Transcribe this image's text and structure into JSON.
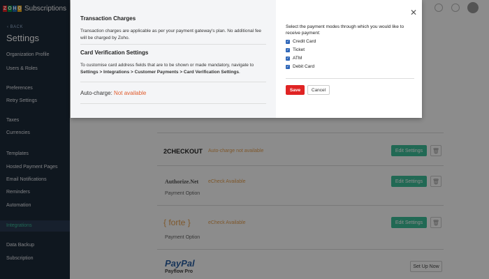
{
  "app": {
    "logo_letters": [
      "Z",
      "O",
      "H",
      "O"
    ],
    "logo_colors": [
      "#e42527",
      "#089949",
      "#226db4",
      "#f9b21d"
    ],
    "name": "Subscriptions"
  },
  "sidebar": {
    "back_label": "‹ BACK",
    "title": "Settings",
    "items": [
      {
        "label": "Organization Profile"
      },
      {
        "label": "Users & Roles"
      },
      {
        "label": "Preferences"
      },
      {
        "label": "Retry Settings"
      },
      {
        "label": "Taxes"
      },
      {
        "label": "Currencies"
      },
      {
        "label": "Templates"
      },
      {
        "label": "Hosted Payment Pages"
      },
      {
        "label": "Email Notifications"
      },
      {
        "label": "Reminders"
      },
      {
        "label": "Automation"
      },
      {
        "label": "Integrations",
        "active": true
      },
      {
        "label": "Data Backup"
      },
      {
        "label": "Subscription"
      }
    ]
  },
  "gateways": [
    {
      "name": "2CHECKOUT",
      "note": "Auto-charge not available",
      "edit_label": "Edit Settings"
    },
    {
      "name": "Authorize.Net",
      "note": "eCheck Available",
      "edit_label": "Edit Settings",
      "option_label": "Payment Option"
    },
    {
      "name": "{ forte }",
      "note": "eCheck Available",
      "edit_label": "Edit Settings",
      "option_label": "Payment Option"
    },
    {
      "name": "PayPal",
      "sub": "Payflow Pro",
      "setup_label": "Set Up Now"
    }
  ],
  "modal": {
    "transaction_title": "Transaction Charges",
    "transaction_text": "Transaction charges are applicable as per your payment gateway's plan. No additional fee will be charged by Zoho.",
    "card_title": "Card Verification Settings",
    "card_text_prefix": "To customise card address fields that are to be shown or made mandatory, navigate to ",
    "card_text_path": "Settings > Integrations > Customer Payments > Card Verification Settings",
    "card_text_suffix": ".",
    "autocharge_label": "Auto-charge:",
    "autocharge_value": "Not available",
    "payment_intro": "Select the payment modes through which you would like to receive payment:",
    "payment_modes": [
      {
        "label": "Credit Card",
        "checked": true
      },
      {
        "label": "Ticket",
        "checked": true
      },
      {
        "label": "ATM",
        "checked": true
      },
      {
        "label": "Debit Card",
        "checked": true
      }
    ],
    "save_label": "Save",
    "cancel_label": "Cancel"
  },
  "colors": {
    "accent": "#3cbf9a",
    "primary_button": "#e02424",
    "warning_text": "#e05a2b",
    "sidebar_bg": "#1d2a3a"
  }
}
